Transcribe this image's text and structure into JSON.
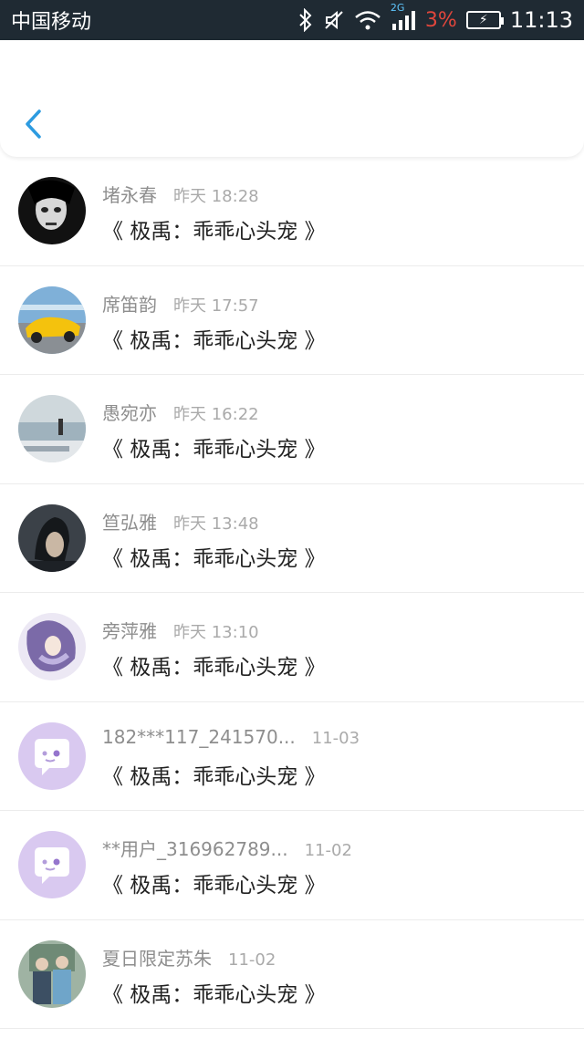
{
  "status_bar": {
    "carrier": "中国移动",
    "network": "2G",
    "battery_percent": "3%",
    "time": "11:13"
  },
  "header": {
    "back_icon": "chevron-left-icon"
  },
  "messages": [
    {
      "name": "堵永春",
      "time": "昨天 18:28",
      "text": "《 极禹：乖乖心头宠 》",
      "avatar": "photo-dark"
    },
    {
      "name": "席笛韵",
      "time": "昨天 17:57",
      "text": "《 极禹：乖乖心头宠 》",
      "avatar": "photo-car"
    },
    {
      "name": "愚宛亦",
      "time": "昨天 16:22",
      "text": "《 极禹：乖乖心头宠 》",
      "avatar": "photo-sea"
    },
    {
      "name": "笪弘雅",
      "time": "昨天 13:48",
      "text": "《 极禹：乖乖心头宠 》",
      "avatar": "photo-sitting"
    },
    {
      "name": "旁萍雅",
      "time": "昨天 13:10",
      "text": "《 极禹：乖乖心头宠 》",
      "avatar": "photo-anime"
    },
    {
      "name": "182***117_241570...",
      "time": "11-03",
      "text": "《 极禹：乖乖心头宠 》",
      "avatar": "default-chat-icon"
    },
    {
      "name": "**用户_316962789...",
      "time": "11-02",
      "text": "《 极禹：乖乖心头宠 》",
      "avatar": "default-chat-icon"
    },
    {
      "name": "夏日限定苏朱",
      "time": "11-02",
      "text": "《 极禹：乖乖心头宠 》",
      "avatar": "photo-two-people"
    }
  ],
  "colors": {
    "status_bar_bg": "#1f2a33",
    "accent_blue": "#2d9be0",
    "battery_low": "#e0463c",
    "default_avatar": "#d9c9f0"
  }
}
